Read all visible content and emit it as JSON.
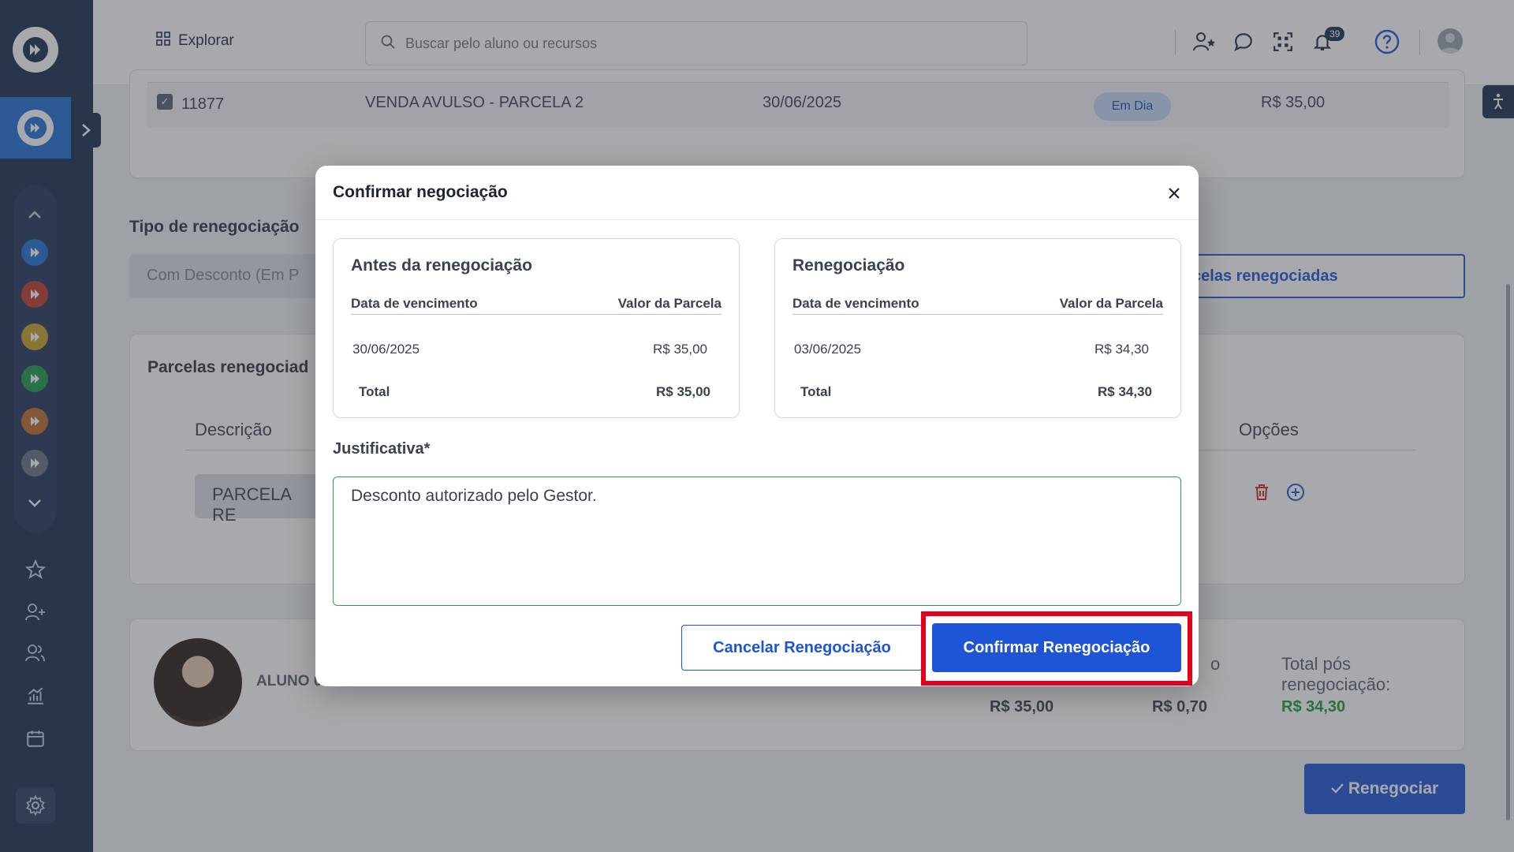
{
  "header": {
    "explorar_label": "Explorar",
    "search_placeholder": "Buscar pelo aluno ou recursos",
    "notifications_count": "39"
  },
  "background": {
    "row": {
      "id": "11877",
      "description": "VENDA AVULSO - PARCELA 2",
      "date": "30/06/2025",
      "status": "Em Dia",
      "value": "R$ 35,00"
    },
    "tipo_label": "Tipo de renegociação",
    "tipo_value": "Com Desconto (Em P",
    "outline_button": "de parcelas renegociadas",
    "parcelas_title": "Parcelas renegociad",
    "col_descricao": "Descrição",
    "col_opcoes": "Opções",
    "parcela_cell": "PARCELA RE",
    "aluno_name": "ALUNO 0",
    "value_1": "R$ 35,00",
    "value_2": "R$ 0,70",
    "fragment_o": "o",
    "total_pos_label": "Total pós renegociação:",
    "total_pos_value": "R$ 34,30",
    "renegociar_button": "Renegociar"
  },
  "modal": {
    "title": "Confirmar negociação",
    "before": {
      "title": "Antes da renegociação",
      "col_date": "Data de vencimento",
      "col_value": "Valor da Parcela",
      "date": "30/06/2025",
      "value": "R$ 35,00",
      "total_label": "Total",
      "total_value": "R$ 35,00"
    },
    "after": {
      "title": "Renegociação",
      "col_date": "Data de vencimento",
      "col_value": "Valor da Parcela",
      "date": "03/06/2025",
      "value": "R$ 34,30",
      "total_label": "Total",
      "total_value": "R$ 34,30"
    },
    "justificativa_label": "Justificativa*",
    "justificativa_value": "Desconto autorizado pelo Gestor.",
    "cancel_label": "Cancelar Renegociação",
    "confirm_label": "Confirmar Renegociação"
  },
  "colors": {
    "brand": "#1b2d4f",
    "primary": "#1e55d6",
    "success": "#1e9a34",
    "highlight": "#e4001b",
    "app_dots": [
      "#1e6fd6",
      "#c0392b",
      "#c9a227",
      "#1e9a4a",
      "#c06a2b",
      "#6b7280"
    ]
  },
  "icons": [
    "logo-icon",
    "chevron-right-icon",
    "chevron-up-icon",
    "chevron-down-icon",
    "star-icon",
    "add-user-icon",
    "users-icon",
    "chart-icon",
    "calendar-icon",
    "gear-icon",
    "grid-icon",
    "search-icon",
    "user-star-icon",
    "chat-icon",
    "qr-icon",
    "bell-icon",
    "help-icon",
    "close-icon",
    "trash-icon",
    "plus-circle-icon",
    "check-icon",
    "accessibility-icon"
  ]
}
